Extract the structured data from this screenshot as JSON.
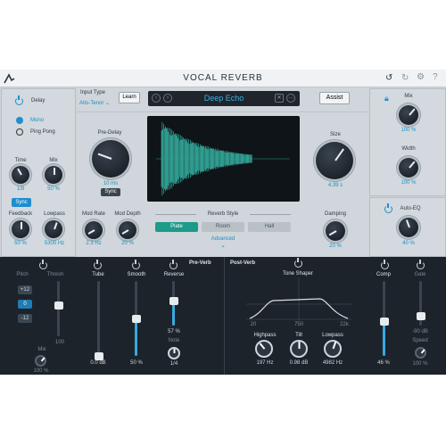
{
  "title": "VOCAL REVERB",
  "header": {
    "input_type_label": "Input Type",
    "input_type_value": "Alto-Tenor",
    "learn": "Learn",
    "preset": "Deep Echo",
    "assist": "Assist"
  },
  "delay": {
    "label": "Delay",
    "modes": [
      "Mono",
      "Ping Pong"
    ],
    "selected": "Mono",
    "time_label": "Time",
    "time_value": "1/8",
    "mix_label": "Mix",
    "mix_value": "50 %",
    "sync": "Sync",
    "feedback_label": "Feedback",
    "feedback_value": "50 %",
    "lowpass_label": "Lowpass",
    "lowpass_value": "5300 Hz"
  },
  "center": {
    "predelay_label": "Pre-Delay",
    "predelay_value": "10 ms",
    "sync": "Sync",
    "size_label": "Size",
    "size_value": "4.39 s",
    "modrate_label": "Mod Rate",
    "modrate_value": "2.3 Hz",
    "moddepth_label": "Mod Depth",
    "moddepth_value": "20 %",
    "style_label": "Reverb Style",
    "styles": [
      "Plate",
      "Room",
      "Hall"
    ],
    "selected_style": "Plate",
    "advanced": "Advanced",
    "damping_label": "Damping",
    "damping_value": "20 %"
  },
  "right": {
    "mix_label": "Mix",
    "mix_value": "100 %",
    "width_label": "Width",
    "width_value": "100 %",
    "autoeq_label": "Auto-EQ",
    "autoeq_value": "40 %"
  },
  "preverb": {
    "title": "Pre-Verb",
    "pitch_label": "Pitch",
    "pitch_values": [
      "+12",
      "0",
      "-12"
    ],
    "pitch_selected": "0",
    "thresh_label": "Thresh",
    "thresh_value": "100",
    "mix_label": "Mix",
    "mix_value": "100 %",
    "tube_label": "Tube",
    "tube_value": "0.0 dB",
    "smooth_label": "Smooth",
    "smooth_value": "50 %",
    "reverse_label": "Reverse",
    "reverse_value": "57 %",
    "note_label": "Note",
    "note_value": "1/4",
    "tube_level": 0.0,
    "smooth_level": 0.5,
    "reverse_level": 0.57
  },
  "postverb": {
    "title": "Post-Verb",
    "tone_shaper": "Tone Shaper",
    "axis": [
      "20",
      "750",
      "22k"
    ],
    "highpass_label": "Highpass",
    "highpass_value": "197 Hz",
    "tilt_label": "Tilt",
    "tilt_value": "0.98 dB",
    "lowpass_label": "Lowpass",
    "lowpass_value": "4982 Hz",
    "comp_label": "Comp",
    "comp_value": "46 %",
    "comp_level": 0.46,
    "gate_label": "Gate",
    "gate_value": "-90 dB",
    "speed_label": "Speed",
    "speed_value": "100 %"
  }
}
